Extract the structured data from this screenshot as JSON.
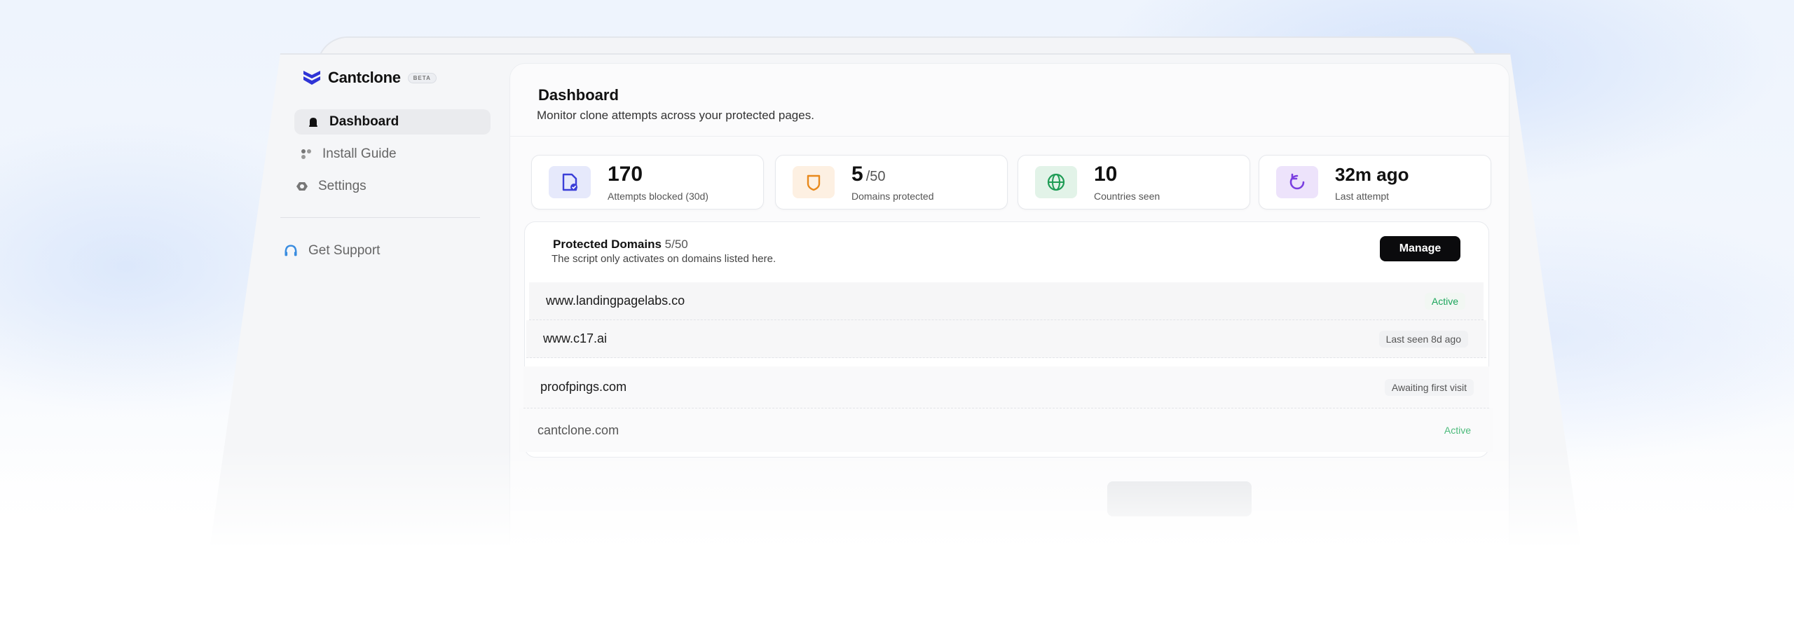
{
  "app": {
    "name": "Cantclone",
    "badge": "BETA"
  },
  "sidebar": {
    "items": [
      {
        "label": "Dashboard",
        "icon": "bell-icon",
        "active": true
      },
      {
        "label": "Install Guide",
        "icon": "dots-icon",
        "active": false
      },
      {
        "label": "Settings",
        "icon": "gear-icon",
        "active": false
      }
    ],
    "support_label": "Get Support"
  },
  "header": {
    "title": "Dashboard",
    "subtitle": "Monitor clone attempts across your protected pages."
  },
  "stats": [
    {
      "value": "170",
      "suffix": "",
      "label": "Attempts blocked (30d)",
      "icon": "shield-check-file-icon",
      "color": "#3b3fd8",
      "bg": "#e6e9fb"
    },
    {
      "value": "5",
      "suffix": "/50",
      "label": "Domains protected",
      "icon": "shield-icon",
      "color": "#e8891c",
      "bg": "#fdf0e2"
    },
    {
      "value": "10",
      "suffix": "",
      "label": "Countries seen",
      "icon": "globe-icon",
      "color": "#1e9c55",
      "bg": "#e2f3e8"
    },
    {
      "value": "32m ago",
      "suffix": "",
      "label": "Last attempt",
      "icon": "refresh-icon",
      "color": "#7a3ee0",
      "bg": "#ede3fb"
    }
  ],
  "domains_panel": {
    "title": "Protected Domains",
    "count": "5/50",
    "description": "The script only activates on domains listed here.",
    "manage_label": "Manage",
    "rows": [
      {
        "domain": "www.landingpagelabs.co",
        "status": "Active",
        "active": true
      },
      {
        "domain": "www.c17.ai",
        "status": "Last seen 8d ago",
        "active": false
      },
      {
        "domain": "proofpings.com",
        "status": "Awaiting first visit",
        "active": false
      },
      {
        "domain": "cantclone.com",
        "status": "Active",
        "active": true
      }
    ]
  }
}
